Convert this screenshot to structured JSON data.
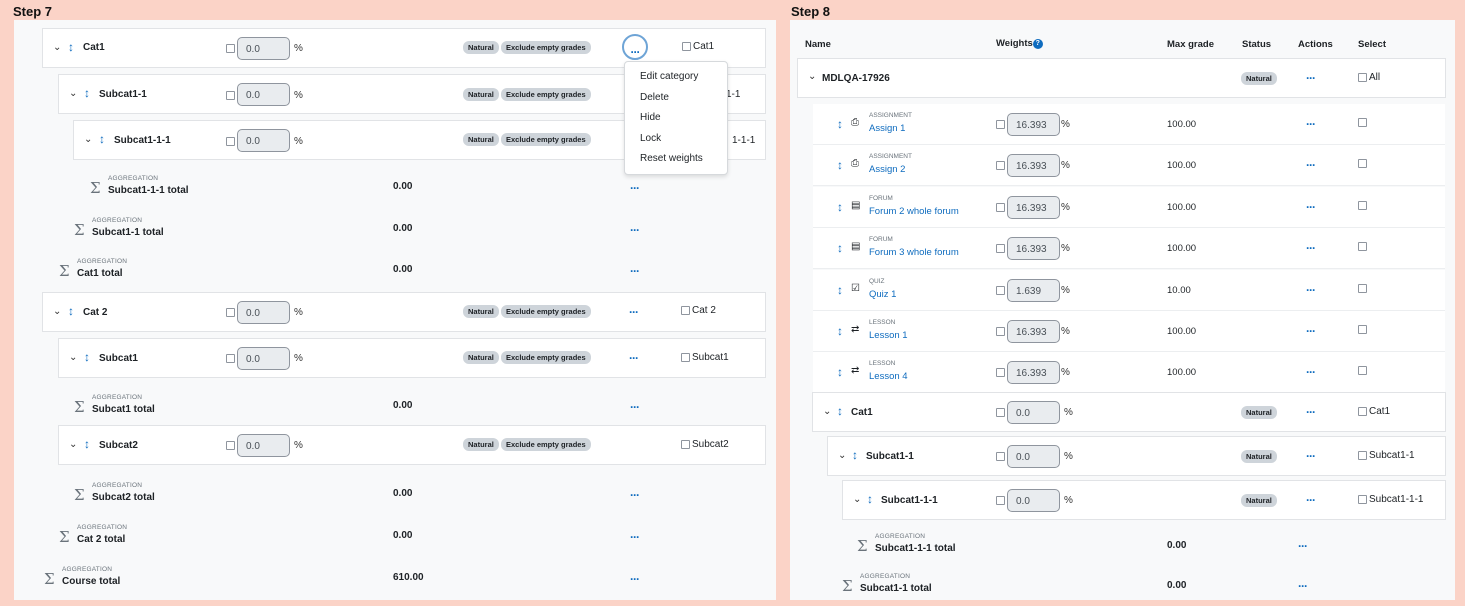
{
  "step7": {
    "title": "Step 7",
    "cats": [
      {
        "name": "Cat1",
        "weight": "0.0",
        "pct": "%",
        "badges": [
          "Natural",
          "Exclude empty grades"
        ],
        "select": "Cat1"
      },
      {
        "name": "Subcat1-1",
        "weight": "0.0",
        "pct": "%",
        "badges": [
          "Natural",
          "Exclude empty grades"
        ],
        "select": "1-1"
      },
      {
        "name": "Subcat1-1-1",
        "weight": "0.0",
        "pct": "%",
        "badges": [
          "Natural",
          "Exclude empty grades"
        ],
        "select": "1-1-1"
      },
      {
        "name": "Cat 2",
        "weight": "0.0",
        "pct": "%",
        "badges": [
          "Natural",
          "Exclude empty grades"
        ],
        "select": "Cat 2"
      },
      {
        "name": "Subcat1",
        "weight": "0.0",
        "pct": "%",
        "badges": [
          "Natural",
          "Exclude empty grades"
        ],
        "select": "Subcat1"
      },
      {
        "name": "Subcat2",
        "weight": "0.0",
        "pct": "%",
        "badges": [
          "Natural",
          "Exclude empty grades"
        ],
        "select": "Subcat2"
      }
    ],
    "totals": [
      {
        "label": "AGGREGATION",
        "name": "Subcat1-1-1 total",
        "value": "0.00"
      },
      {
        "label": "AGGREGATION",
        "name": "Subcat1-1 total",
        "value": "0.00"
      },
      {
        "label": "AGGREGATION",
        "name": "Cat1 total",
        "value": "0.00"
      },
      {
        "label": "AGGREGATION",
        "name": "Subcat1 total",
        "value": "0.00"
      },
      {
        "label": "AGGREGATION",
        "name": "Subcat2 total",
        "value": "0.00"
      },
      {
        "label": "AGGREGATION",
        "name": "Cat 2 total",
        "value": "0.00"
      },
      {
        "label": "AGGREGATION",
        "name": "Course total",
        "value": "610.00"
      }
    ],
    "menu": [
      "Edit category",
      "Delete",
      "Hide",
      "Lock",
      "Reset weights"
    ]
  },
  "step8": {
    "title": "Step 8",
    "headers": {
      "name": "Name",
      "weights": "Weights",
      "max": "Max grade",
      "status": "Status",
      "actions": "Actions",
      "select": "Select"
    },
    "course": {
      "name": "MDLQA-17926",
      "badge": "Natural",
      "select": "All"
    },
    "items": [
      {
        "type": "ASSIGNMENT",
        "name": "Assign 1",
        "weight": "16.393",
        "pct": "%",
        "max": "100.00",
        "icon": "assignment-icon"
      },
      {
        "type": "ASSIGNMENT",
        "name": "Assign 2",
        "weight": "16.393",
        "pct": "%",
        "max": "100.00",
        "icon": "assignment-icon"
      },
      {
        "type": "FORUM",
        "name": "Forum 2 whole forum",
        "weight": "16.393",
        "pct": "%",
        "max": "100.00",
        "icon": "forum-icon"
      },
      {
        "type": "FORUM",
        "name": "Forum 3 whole forum",
        "weight": "16.393",
        "pct": "%",
        "max": "100.00",
        "icon": "forum-icon"
      },
      {
        "type": "QUIZ",
        "name": "Quiz 1",
        "weight": "1.639",
        "pct": "%",
        "max": "10.00",
        "icon": "quiz-icon"
      },
      {
        "type": "LESSON",
        "name": "Lesson 1",
        "weight": "16.393",
        "pct": "%",
        "max": "100.00",
        "icon": "lesson-icon"
      },
      {
        "type": "LESSON",
        "name": "Lesson 4",
        "weight": "16.393",
        "pct": "%",
        "max": "100.00",
        "icon": "lesson-icon"
      }
    ],
    "cats": [
      {
        "name": "Cat1",
        "weight": "0.0",
        "pct": "%",
        "badge": "Natural",
        "select": "Cat1"
      },
      {
        "name": "Subcat1-1",
        "weight": "0.0",
        "pct": "%",
        "badge": "Natural",
        "select": "Subcat1-1"
      },
      {
        "name": "Subcat1-1-1",
        "weight": "0.0",
        "pct": "%",
        "badge": "Natural",
        "select": "Subcat1-1-1"
      }
    ],
    "totals": [
      {
        "label": "AGGREGATION",
        "name": "Subcat1-1-1 total",
        "value": "0.00"
      },
      {
        "label": "AGGREGATION",
        "name": "Subcat1-1 total",
        "value": "0.00"
      }
    ]
  }
}
